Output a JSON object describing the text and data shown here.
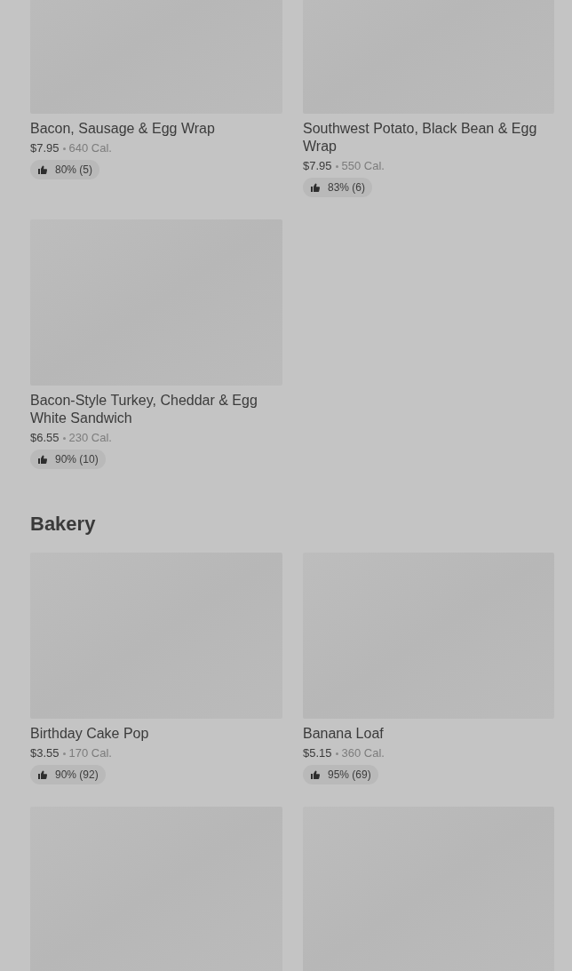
{
  "sections": [
    {
      "items": [
        {
          "kind": "full",
          "name": "Bacon, Sausage & Egg Wrap",
          "price": "$7.95",
          "calories": "640 Cal.",
          "rating": "80% (5)"
        },
        {
          "kind": "full",
          "name": "Southwest Potato, Black Bean & Egg Wrap",
          "price": "$7.95",
          "calories": "550 Cal.",
          "rating": "83% (6)"
        },
        {
          "kind": "full",
          "name": "Bacon-Style Turkey, Cheddar & Egg White Sandwich",
          "price": "$6.55",
          "calories": "230 Cal.",
          "rating": "90% (10)"
        }
      ]
    },
    {
      "title": "Bakery",
      "items": [
        {
          "kind": "full",
          "name": "Birthday Cake Pop",
          "price": "$3.55",
          "calories": "170 Cal.",
          "rating": "90% (92)"
        },
        {
          "kind": "full",
          "name": "Banana Loaf",
          "price": "$5.15",
          "calories": "360 Cal.",
          "rating": "95% (69)"
        },
        {
          "kind": "image_only"
        },
        {
          "kind": "image_only"
        }
      ]
    }
  ]
}
